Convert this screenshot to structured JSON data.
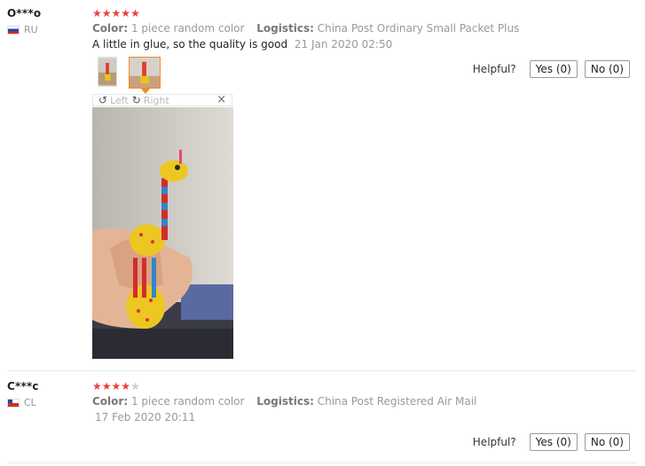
{
  "reviews": [
    {
      "user": "O***o",
      "country": "RU",
      "rating": 5,
      "color_label": "Color:",
      "color_value": "1 piece random color",
      "logistics_label": "Logistics:",
      "logistics_value": "China Post Ordinary Small Packet Plus",
      "text": "A little in glue, so the quality is good",
      "date": "21 Jan 2020 02:50",
      "viewer": {
        "left_label": "Left",
        "right_label": "Right",
        "close": "×"
      },
      "helpful_label": "Helpful?",
      "yes_label": "Yes (0)",
      "no_label": "No (0)"
    },
    {
      "user": "C***c",
      "country": "CL",
      "rating": 4,
      "color_label": "Color:",
      "color_value": "1 piece random color",
      "logistics_label": "Logistics:",
      "logistics_value": "China Post Registered Air Mail",
      "date": "17 Feb 2020 20:11",
      "helpful_label": "Helpful?",
      "yes_label": "Yes (0)",
      "no_label": "No (0)"
    }
  ],
  "colors": {
    "star": "#ee3f3a",
    "thumb_active": "#f48a2a"
  },
  "icons": {
    "rotate_left": "rotate-left-icon",
    "rotate_right": "rotate-right-icon"
  }
}
